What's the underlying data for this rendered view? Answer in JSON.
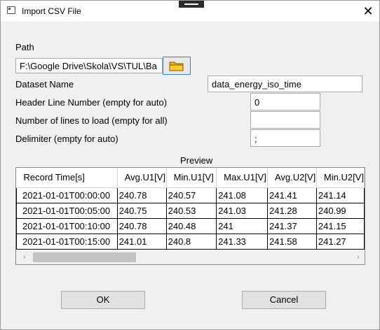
{
  "window": {
    "title": "Import CSV File",
    "icon": "app-window-icon",
    "close_icon": "close-icon",
    "close_glyph": "✕"
  },
  "form": {
    "path_label": "Path",
    "path_value": "F:\\Google Drive\\Skola\\VS\\TUL\\Ba",
    "browse_icon": "folder-icon",
    "dataset_label": "Dataset Name",
    "dataset_value": "data_energy_iso_time",
    "header_label": "Header Line Number (empty for auto)",
    "header_value": "0",
    "lines_label": "Number of lines to load (empty for all)",
    "lines_value": "",
    "delimiter_label": "Delimiter (empty for auto)",
    "delimiter_value": ";"
  },
  "preview": {
    "title": "Preview",
    "columns": [
      "Record Time[s]",
      "Avg.U1[V]",
      "Min.U1[V]",
      "Max.U1[V]",
      "Avg.U2[V]",
      "Min.U2[V]"
    ],
    "rows": [
      [
        "2021-01-01T00:00:00",
        "240.78",
        "240.57",
        "241.08",
        "241.41",
        "241.14"
      ],
      [
        "2021-01-01T00:05:00",
        "240.75",
        "240.53",
        "241.03",
        "241.28",
        "240.99"
      ],
      [
        "2021-01-01T00:10:00",
        "240.78",
        "240.48",
        "241",
        "241.37",
        "241.15"
      ],
      [
        "2021-01-01T00:15:00",
        "241.01",
        "240.8",
        "241.33",
        "241.58",
        "241.27"
      ]
    ],
    "scroll_left_glyph": "‹",
    "scroll_right_glyph": "›"
  },
  "buttons": {
    "ok": "OK",
    "cancel": "Cancel"
  },
  "colors": {
    "folder": "#f5b800",
    "folder_outline": "#7a5a00",
    "focus_border": "#3c7fb1"
  }
}
